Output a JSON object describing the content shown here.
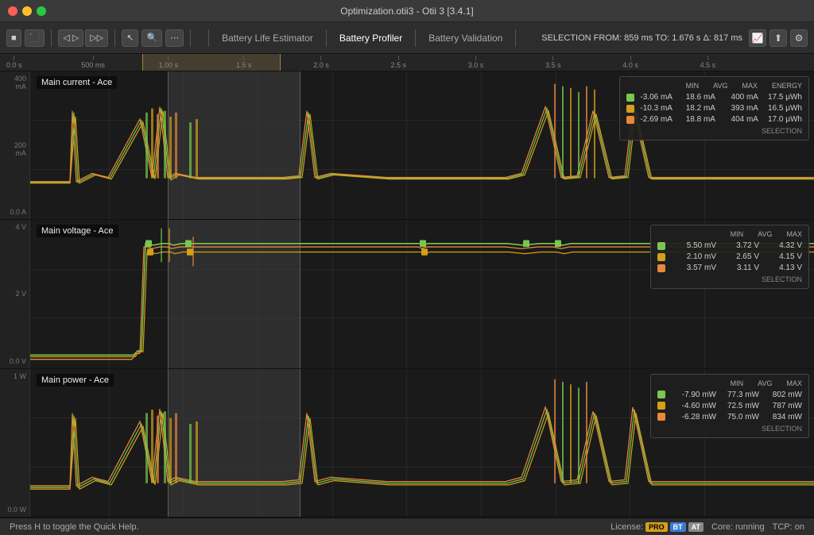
{
  "window": {
    "title": "Optimization.otii3 - Otii 3 [3.4.1]"
  },
  "nav_tabs": [
    {
      "label": "Battery Life Estimator",
      "active": false
    },
    {
      "label": "Battery Profiler",
      "active": true
    },
    {
      "label": "Battery Validation",
      "active": false
    }
  ],
  "selection": {
    "label": "SELECTION",
    "from": "FROM: 859 ms",
    "to": "TO: 1.676 s",
    "delta": "Δ: 817 ms"
  },
  "timeline": {
    "marks": [
      "0.0 s",
      "500 ms",
      "1.00 s",
      "1.5 s",
      "2.0 s",
      "2.5 s",
      "3.0 s",
      "3.5 s",
      "4.0 s",
      "4.5 s"
    ]
  },
  "charts": [
    {
      "id": "main-current",
      "label": "Main current - Ace",
      "y_labels": [
        "400 mA",
        "200 mA",
        "0.0 A"
      ],
      "legend": {
        "headers": [
          "MIN",
          "AVG",
          "MAX",
          "ENERGY"
        ],
        "rows": [
          {
            "color": "#7ac74f",
            "min": "-3.06 mA",
            "avg": "18.6 mA",
            "max": "400 mA",
            "energy": "17.5 μWh"
          },
          {
            "color": "#d4a017",
            "min": "-10.3 mA",
            "avg": "18.2 mA",
            "max": "393 mA",
            "energy": "16.5 μWh"
          },
          {
            "color": "#e8883a",
            "min": "-2.69 mA",
            "avg": "18.8 mA",
            "max": "404 mA",
            "energy": "17.0 μWh"
          }
        ],
        "selection_label": "SELECTION"
      }
    },
    {
      "id": "main-voltage",
      "label": "Main voltage - Ace",
      "y_labels": [
        "4 V",
        "2 V",
        "0.0 V"
      ],
      "legend": {
        "headers": [
          "MIN",
          "AVG",
          "MAX"
        ],
        "rows": [
          {
            "color": "#7ac74f",
            "min": "5.50 mV",
            "avg": "3.72 V",
            "max": "4.32 V",
            "energy": null
          },
          {
            "color": "#d4a017",
            "min": "2.10 mV",
            "avg": "2.65 V",
            "max": "4.15 V",
            "energy": null
          },
          {
            "color": "#e8883a",
            "min": "3.57 mV",
            "avg": "3.11 V",
            "max": "4.13 V",
            "energy": null
          }
        ],
        "selection_label": "SELECTION"
      }
    },
    {
      "id": "main-power",
      "label": "Main power - Ace",
      "y_labels": [
        "1 W",
        "",
        "0.0 W"
      ],
      "legend": {
        "headers": [
          "MIN",
          "AVG",
          "MAX"
        ],
        "rows": [
          {
            "color": "#7ac74f",
            "min": "-7.90 mW",
            "avg": "77.3 mW",
            "max": "802 mW",
            "energy": null
          },
          {
            "color": "#d4a017",
            "min": "-4.60 mW",
            "avg": "72.5 mW",
            "max": "787 mW",
            "energy": null
          },
          {
            "color": "#e8883a",
            "min": "-6.28 mW",
            "avg": "75.0 mW",
            "max": "834 mW",
            "energy": null
          }
        ],
        "selection_label": "SELECTION"
      }
    }
  ],
  "statusbar": {
    "help_text": "Press H to toggle the Quick Help.",
    "license_label": "License:",
    "badges": [
      "PRO",
      "BT",
      "AT"
    ],
    "core_label": "Core: running",
    "tcp_label": "TCP: on"
  }
}
